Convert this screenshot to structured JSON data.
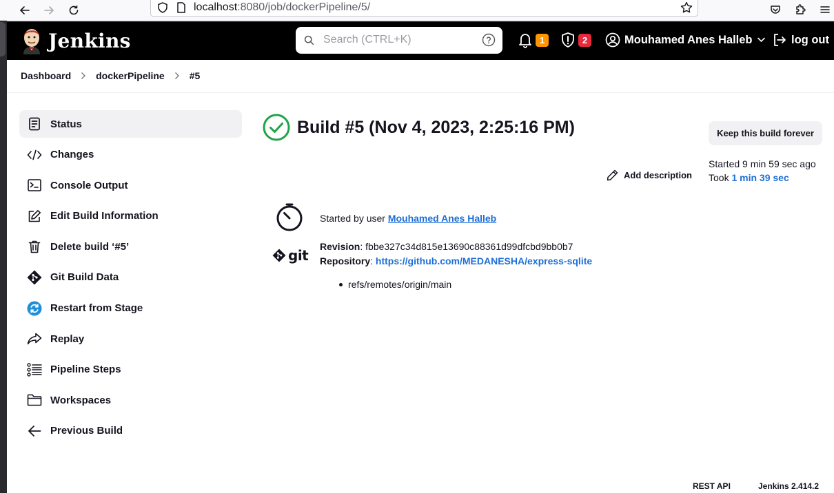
{
  "browser": {
    "url_host": "localhost",
    "url_rest": ":8080/job/dockerPipeline/5/"
  },
  "header": {
    "logo_text": "Jenkins",
    "search_placeholder": "Search (CTRL+K)",
    "notifications_count": "1",
    "security_count": "2",
    "user_name": "Mouhamed Anes Halleb",
    "logout_label": "log out"
  },
  "breadcrumb": [
    "Dashboard",
    "dockerPipeline",
    "#5"
  ],
  "sidebar": {
    "items": [
      {
        "label": "Status",
        "icon": "document-icon"
      },
      {
        "label": "Changes",
        "icon": "code-icon"
      },
      {
        "label": "Console Output",
        "icon": "terminal-icon"
      },
      {
        "label": "Edit Build Information",
        "icon": "edit-icon"
      },
      {
        "label": "Delete build ‘#5’",
        "icon": "trash-icon"
      },
      {
        "label": "Git Build Data",
        "icon": "git-icon"
      },
      {
        "label": "Restart from Stage",
        "icon": "restart-icon"
      },
      {
        "label": "Replay",
        "icon": "replay-icon"
      },
      {
        "label": "Pipeline Steps",
        "icon": "list-icon"
      },
      {
        "label": "Workspaces",
        "icon": "folder-icon"
      },
      {
        "label": "Previous Build",
        "icon": "arrow-left-icon"
      }
    ]
  },
  "build": {
    "title": "Build #5 (Nov 4, 2023, 2:25:16 PM)",
    "keep_label": "Keep this build forever",
    "add_description_label": "Add description",
    "started_ago": "Started 9 min 59 sec ago",
    "took_label": "Took ",
    "took_value": "1 min 39 sec",
    "started_by_prefix": "Started by user ",
    "started_by_user": "Mouhamed Anes Halleb",
    "revision_label": "Revision",
    "revision_value": "fbbe327c34d815e13690c88361d99dfcbd9bb0b7",
    "repository_label": "Repository",
    "repository_value": "https://github.com/MEDANESHA/express-sqlite",
    "branch": "refs/remotes/origin/main"
  },
  "footer": {
    "rest_api": "REST API",
    "version": "Jenkins 2.414.2"
  },
  "colors": {
    "success": "#1ea446",
    "link": "#1d6fd6",
    "header_bg": "#000000",
    "badge_orange": "#ff9500",
    "badge_red": "#e6293d"
  }
}
